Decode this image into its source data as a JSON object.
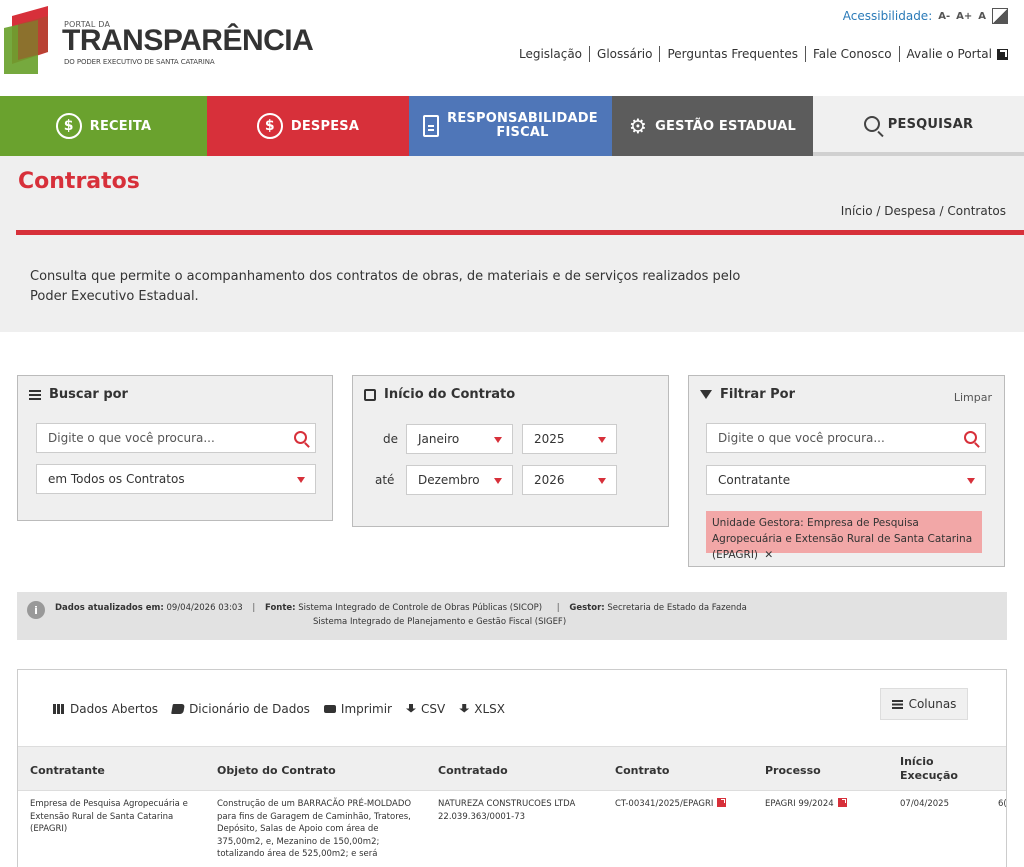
{
  "header": {
    "logo_small": "PORTAL DA",
    "logo_big": "TRANSPARÊNCIA",
    "logo_sub": "DO PODER EXECUTIVO DE SANTA CATARINA",
    "accessibility_label": "Acessibilidade:",
    "font_decrease": "A-",
    "font_increase": "A+",
    "font_reset": "A",
    "links": [
      "Legislação",
      "Glossário",
      "Perguntas Frequentes",
      "Fale Conosco",
      "Avalie o Portal"
    ]
  },
  "nav": {
    "receita": "RECEITA",
    "despesa": "DESPESA",
    "resp_line1": "RESPONSABILIDADE",
    "resp_line2": "FISCAL",
    "gestao": "GESTÃO ESTADUAL",
    "pesquisar": "PESQUISAR",
    "colors": {
      "receita": "#6aa22e",
      "despesa": "#d7303a",
      "resp": "#4f76b8",
      "gestao": "#5c5c5c"
    }
  },
  "page": {
    "title": "Contratos",
    "breadcrumb": "Início / Despesa / Contratos",
    "description": "Consulta que permite o acompanhamento dos contratos de obras, de materiais e de serviços realizados pelo Poder Executivo Estadual."
  },
  "buscar": {
    "title": "Buscar por",
    "placeholder": "Digite o que você procura...",
    "scope": "em Todos os Contratos"
  },
  "inicio": {
    "title": "Início do Contrato",
    "de_label": "de",
    "ate_label": "até",
    "from_month": "Janeiro",
    "from_year": "2025",
    "to_month": "Dezembro",
    "to_year": "2026"
  },
  "filtrar": {
    "title": "Filtrar Por",
    "clear": "Limpar",
    "placeholder": "Digite o que você procura...",
    "field": "Contratante",
    "active_filter": "Unidade Gestora: Empresa de Pesquisa Agropecuária e Extensão Rural de Santa Catarina (EPAGRI)",
    "remove": "✕"
  },
  "info": {
    "updated_label": "Dados atualizados em:",
    "updated_value": "09/04/2026 03:03",
    "source_label": "Fonte:",
    "source_1": "Sistema Integrado de Controle de Obras Públicas (SICOP)",
    "source_2": "Sistema Integrado de Planejamento e Gestão Fiscal (SIGEF)",
    "manager_label": "Gestor:",
    "manager_value": "Secretaria de Estado da Fazenda"
  },
  "tools": {
    "open_data": "Dados Abertos",
    "dictionary": "Dicionário de Dados",
    "print": "Imprimir",
    "csv": "CSV",
    "xlsx": "XLSX",
    "columns": "Colunas"
  },
  "table": {
    "headers": [
      "Contratante",
      "Objeto do Contrato",
      "Contratado",
      "Contrato",
      "Processo",
      "Início",
      "Execução"
    ],
    "row": {
      "contratante": [
        "Empresa de Pesquisa Agropecuária e",
        "Extensão Rural de Santa Catarina",
        "(EPAGRI)"
      ],
      "objeto": [
        "Construção de um BARRACÃO PRÉ-MOLDADO",
        "para fins de Garagem de Caminhão, Tratores,",
        "Depósito, Salas de Apoio com área de",
        "375,00m2, e, Mezanino de 150,00m2;",
        "totalizando área de 525,00m2; e será"
      ],
      "contratado": [
        "NATUREZA CONSTRUCOES LTDA",
        "22.039.363/0001-73"
      ],
      "contrato": "CT-00341/2025/EPAGRI",
      "processo": "EPAGRI 99/2024",
      "inicio": "07/04/2025",
      "cut": "6("
    }
  }
}
